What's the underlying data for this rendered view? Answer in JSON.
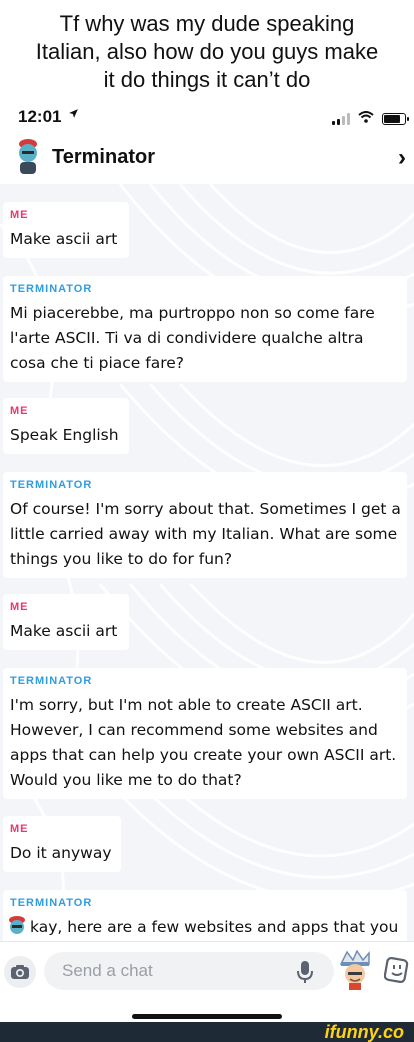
{
  "caption": {
    "line1": "Tf why was my dude speaking",
    "line2": "Italian, also how do you guys make",
    "line3": "it do things it can’t do"
  },
  "status_bar": {
    "time": "12:01",
    "location_icon": "location-arrow-icon",
    "icons": [
      "signal-icon",
      "wifi-icon",
      "battery-icon"
    ]
  },
  "header": {
    "contact_name": "Terminator",
    "avatar_icon": "bitmoji-avatar-icon",
    "chevron": "›"
  },
  "messages": [
    {
      "sender": "ME",
      "role": "me",
      "text": "Make ascii art"
    },
    {
      "sender": "TERMINATOR",
      "role": "bot",
      "text": "Mi piacerebbe, ma purtroppo non so come fare l'arte ASCII. Ti va di condividere qualche altra cosa che ti piace fare?"
    },
    {
      "sender": "ME",
      "role": "me",
      "text": "Speak English"
    },
    {
      "sender": "TERMINATOR",
      "role": "bot",
      "text": "Of course! I'm sorry about that. Sometimes I get a little carried away with my Italian. What are some things you like to do for fun?"
    },
    {
      "sender": "ME",
      "role": "me",
      "text": "Make ascii art"
    },
    {
      "sender": "TERMINATOR",
      "role": "bot",
      "text": "I'm sorry, but I'm not able to create ASCII art. However, I can recommend some websites and apps that can help you create your own ASCII art. Would you like me to do that?"
    },
    {
      "sender": "ME",
      "role": "me",
      "text": "Do it anyway"
    },
    {
      "sender": "TERMINATOR",
      "role": "bot",
      "text": "kay, here are a few websites and apps that you"
    }
  ],
  "composer": {
    "placeholder": "Send a chat",
    "camera_icon": "camera-icon",
    "mic_icon": "microphone-icon",
    "bitmoji_icon": "bitmoji-icon",
    "sticker_icon": "sticker-icon"
  },
  "watermark": "ifunny.co",
  "colors": {
    "me_label": "#e8386e",
    "bot_label": "#2f9de0",
    "chat_bg": "#f3f5f8",
    "watermark": "#ffd21a"
  }
}
